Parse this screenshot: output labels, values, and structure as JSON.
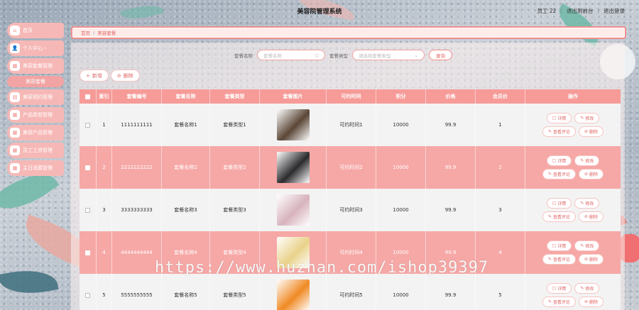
{
  "header": {
    "title": "美容院管理系统",
    "user_label": "员工 22",
    "back_label": "退出到前台",
    "logout_label": "退出登录"
  },
  "sidebar": {
    "items": [
      {
        "label": "首页",
        "icon": "home-icon"
      },
      {
        "label": "个人中心 ›",
        "icon": "user-icon"
      },
      {
        "label": "美容套餐管理",
        "icon": "grid-icon"
      },
      {
        "label": "美容套餐",
        "sub": true
      },
      {
        "label": "美容预约管理",
        "icon": "calendar-icon"
      },
      {
        "label": "产品类型管理",
        "icon": "grid-icon"
      },
      {
        "label": "美容产品管理",
        "icon": "grid-icon"
      },
      {
        "label": "员工工资管理",
        "icon": "grid-icon"
      },
      {
        "label": "主日消费管理",
        "icon": "grid-icon"
      }
    ]
  },
  "breadcrumb": {
    "home": "首页",
    "current": "美容套餐"
  },
  "search": {
    "name_label": "套餐名称",
    "name_placeholder": "套餐名称",
    "type_label": "套餐类型",
    "type_placeholder": "请选择套餐类型",
    "query_label": "查询"
  },
  "actions": {
    "add_label": "新增",
    "delete_label": "删除"
  },
  "table": {
    "headers": [
      "索引",
      "套餐编号",
      "套餐名称",
      "套餐类型",
      "套餐图片",
      "可约时间",
      "积分",
      "价格",
      "会员价",
      "操作"
    ],
    "rows": [
      {
        "idx": "1",
        "code": "1111111111",
        "name": "套餐名称1",
        "type": "套餐类型1",
        "time": "可约时间1",
        "points": "10000",
        "price": "99.9",
        "member": "1",
        "img_color": "#5a4636"
      },
      {
        "idx": "2",
        "code": "2222222222",
        "name": "套餐名称2",
        "type": "套餐类型2",
        "time": "可约时间2",
        "points": "10000",
        "price": "99.9",
        "member": "2",
        "img_color": "#2b2b2e"
      },
      {
        "idx": "3",
        "code": "3333333333",
        "name": "套餐名称3",
        "type": "套餐类型3",
        "time": "可约时间3",
        "points": "10000",
        "price": "99.9",
        "member": "3",
        "img_color": "#d7b3bd"
      },
      {
        "idx": "4",
        "code": "4444444444",
        "name": "套餐名称4",
        "type": "套餐类型4",
        "time": "可约时间4",
        "points": "10000",
        "price": "99.9",
        "member": "4",
        "img_color": "#e9d28a"
      },
      {
        "idx": "5",
        "code": "5555555555",
        "name": "套餐名称5",
        "type": "套餐类型5",
        "time": "可约时间5",
        "points": "10000",
        "price": "99.9",
        "member": "5",
        "img_color": "#f08a24"
      }
    ],
    "ops": {
      "detail": "详情",
      "edit": "修改",
      "review": "查看评论",
      "delete": "删除"
    }
  },
  "watermark": "https://www.huzhan.com/ishop39397"
}
